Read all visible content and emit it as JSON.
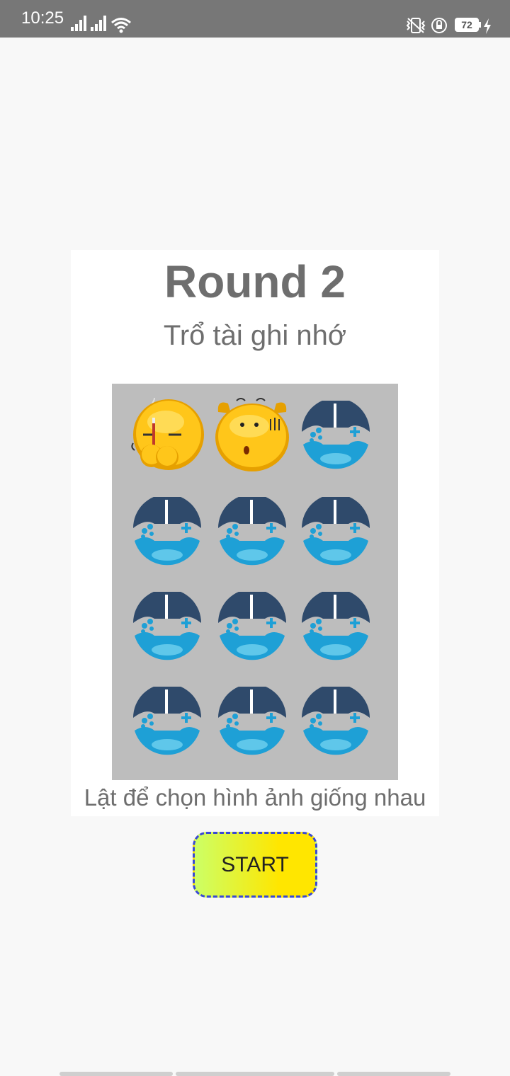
{
  "status_bar": {
    "time": "10:25",
    "battery_level": "72",
    "icons": [
      "signal-icon",
      "signal-icon",
      "wifi-icon",
      "vibrate-icon",
      "rotation-lock-icon",
      "battery-icon",
      "charging-icon"
    ]
  },
  "game": {
    "round_title": "Round 2",
    "subtitle": "Trổ tài ghi nhớ",
    "instruction": "Lật để chọn hình ảnh giống nhau",
    "start_label": "START",
    "board": {
      "rows": 4,
      "cols": 3,
      "tiles": [
        "smoking-emoji",
        "surprised-emoji",
        "gamepad-card-back",
        "gamepad-card-back",
        "gamepad-card-back",
        "gamepad-card-back",
        "gamepad-card-back",
        "gamepad-card-back",
        "gamepad-card-back",
        "gamepad-card-back",
        "gamepad-card-back",
        "gamepad-card-back"
      ]
    }
  },
  "colors": {
    "title_text": "#6e6e6e",
    "board_bg": "#bdbdbd",
    "button_border": "#3949d4",
    "button_gradient_start": "#ccff66",
    "button_gradient_end": "#ffe600",
    "card_navy": "#2f4a6b",
    "card_blue": "#1ea0d6"
  }
}
